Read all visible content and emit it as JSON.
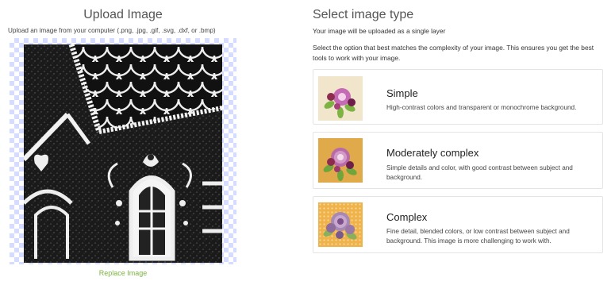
{
  "upload": {
    "title": "Upload Image",
    "subtitle": "Upload an image from your computer (.png, .jpg, .gif, .svg, .dxf, or .bmp)",
    "replace_label": "Replace Image"
  },
  "select": {
    "title": "Select image type",
    "single_layer": "Your image will be uploaded as a single layer",
    "instructions": "Select the option that best matches the complexity of your image. This ensures you get the best tools to work with your image.",
    "options": [
      {
        "title": "Simple",
        "description": "High-contrast colors and transparent or monochrome background."
      },
      {
        "title": "Moderately complex",
        "description": "Simple details and color, with good contrast between subject and background."
      },
      {
        "title": "Complex",
        "description": "Fine detail, blended colors, or low contrast between subject and background. This image is more challenging to work with."
      }
    ]
  },
  "colors": {
    "accent_link": "#7cb342",
    "transparency_check": "#d6dcff"
  }
}
